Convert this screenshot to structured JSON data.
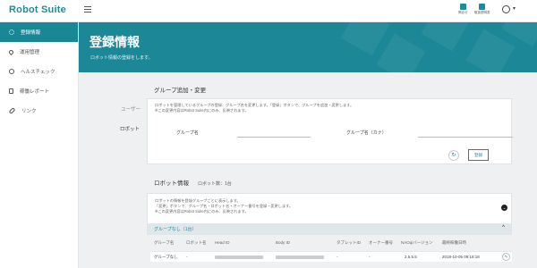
{
  "app": {
    "title": "Robot Suite"
  },
  "top_actions": [
    {
      "label": "問合せ",
      "icon": "phone-icon"
    },
    {
      "label": "取扱説明書",
      "icon": "book-icon"
    }
  ],
  "sidebar": {
    "items": [
      {
        "label": "登録情報",
        "icon": "gear-icon",
        "active": true
      },
      {
        "label": "運用管理",
        "icon": "location-pin-icon"
      },
      {
        "label": "ヘルスチェック",
        "icon": "heart-icon"
      },
      {
        "label": "稼働レポート",
        "icon": "report-icon"
      },
      {
        "label": "リンク",
        "icon": "link-icon"
      }
    ]
  },
  "banner": {
    "title": "登録情報",
    "subtitle": "ロボット情報の登録をします。"
  },
  "tabs": [
    "ユーザー",
    "ロボット"
  ],
  "group_section": {
    "title": "グループ追加・変更",
    "desc1": "ロボットを管理しているグループの登録、グループ名を変更します。「登録」ボタンで、グループを追加・変更します。",
    "desc2": "※この変更内容はRobot Suite内にのみ、反映されます。",
    "label_name": "グループ名",
    "label_kana": "グループ名（カナ）",
    "reset_icon": "↻",
    "save_label": "登録"
  },
  "robot_section": {
    "title": "ロボット情報",
    "count": "ロボット数：1台",
    "desc1": "ロボットの情報を登録グループごとに表示します。",
    "desc2": "「変更」ボタンで、グループ名・ロボット名・オーナー番号を登録・変更します。",
    "desc3": "※この変更内容はRobot Suite内にのみ、反映されます。",
    "toggle_icon": "⌄",
    "group_label": "グループなし（1台）",
    "group_caret": "^",
    "columns": [
      "グループ名",
      "ロボット名",
      "Head ID",
      "Body ID",
      "タブレットID",
      "オーナー番号",
      "NAOqiバージョン",
      "最終稼働日時"
    ],
    "rows": [
      {
        "group": "グループなし",
        "robot": "-",
        "tablet": "-",
        "owner": "-",
        "naoqi": "2.5.5.5",
        "last_active": "2018-10-05 09:18:18",
        "edit_icon": "✎"
      }
    ]
  },
  "colors": {
    "accent": "#1a8796",
    "banner": "#1c8796",
    "background": "#eef0f1"
  }
}
